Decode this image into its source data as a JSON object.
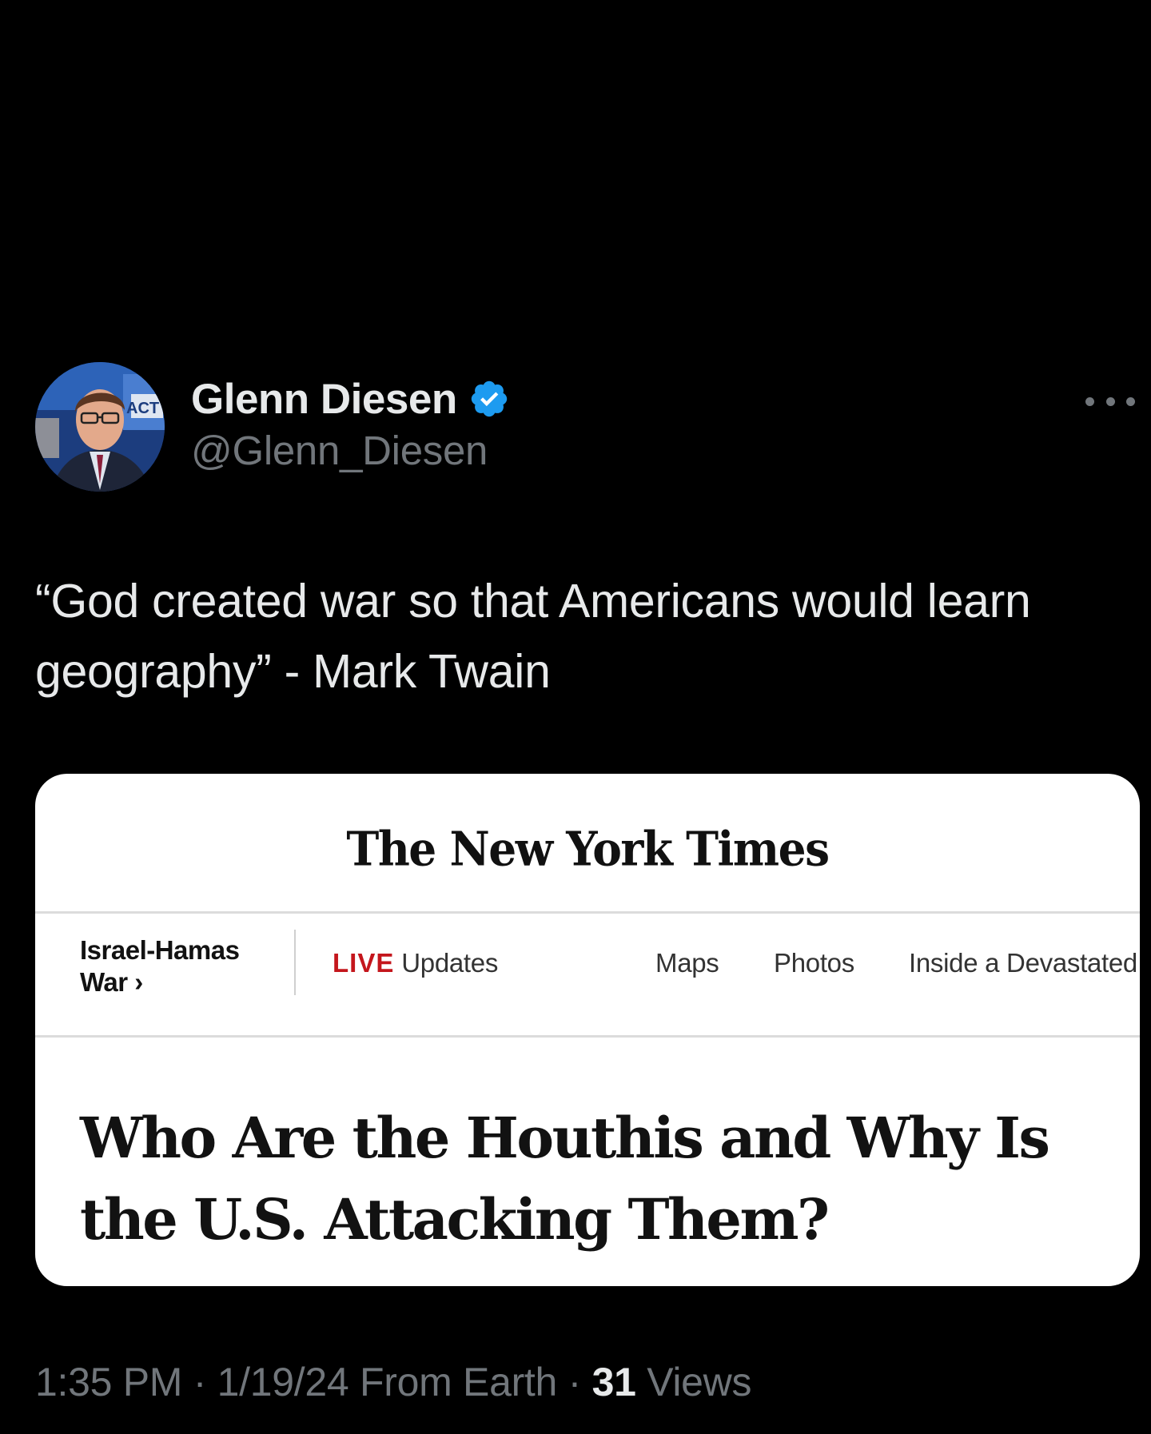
{
  "author": {
    "display_name": "Glenn Diesen",
    "handle": "@Glenn_Diesen",
    "verified": true,
    "verified_icon": "verified-badge-icon",
    "avatar_badge_text": "ACT"
  },
  "tweet": {
    "text": "“God created war so that Americans would learn geography” - Mark Twain"
  },
  "media": {
    "masthead": "The New York Times",
    "section_label": "Israel-Hamas War ›",
    "nav": {
      "live_label": "LIVE",
      "updates_label": "Updates",
      "maps_label": "Maps",
      "photos_label": "Photos",
      "inside_label": "Inside a Devastated"
    },
    "headline": "Who Are the Houthis and Why Is the U.S. Attacking Them?"
  },
  "meta": {
    "time": "1:35 PM",
    "separator": " · ",
    "date": "1/19/24",
    "source": "From Earth",
    "views_count": "31",
    "views_label": "Views"
  },
  "colors": {
    "background": "#000000",
    "primary_text": "#e7e9ea",
    "secondary_text": "#71767b",
    "verified_blue": "#1d9bf0",
    "live_red": "#c4161c"
  }
}
